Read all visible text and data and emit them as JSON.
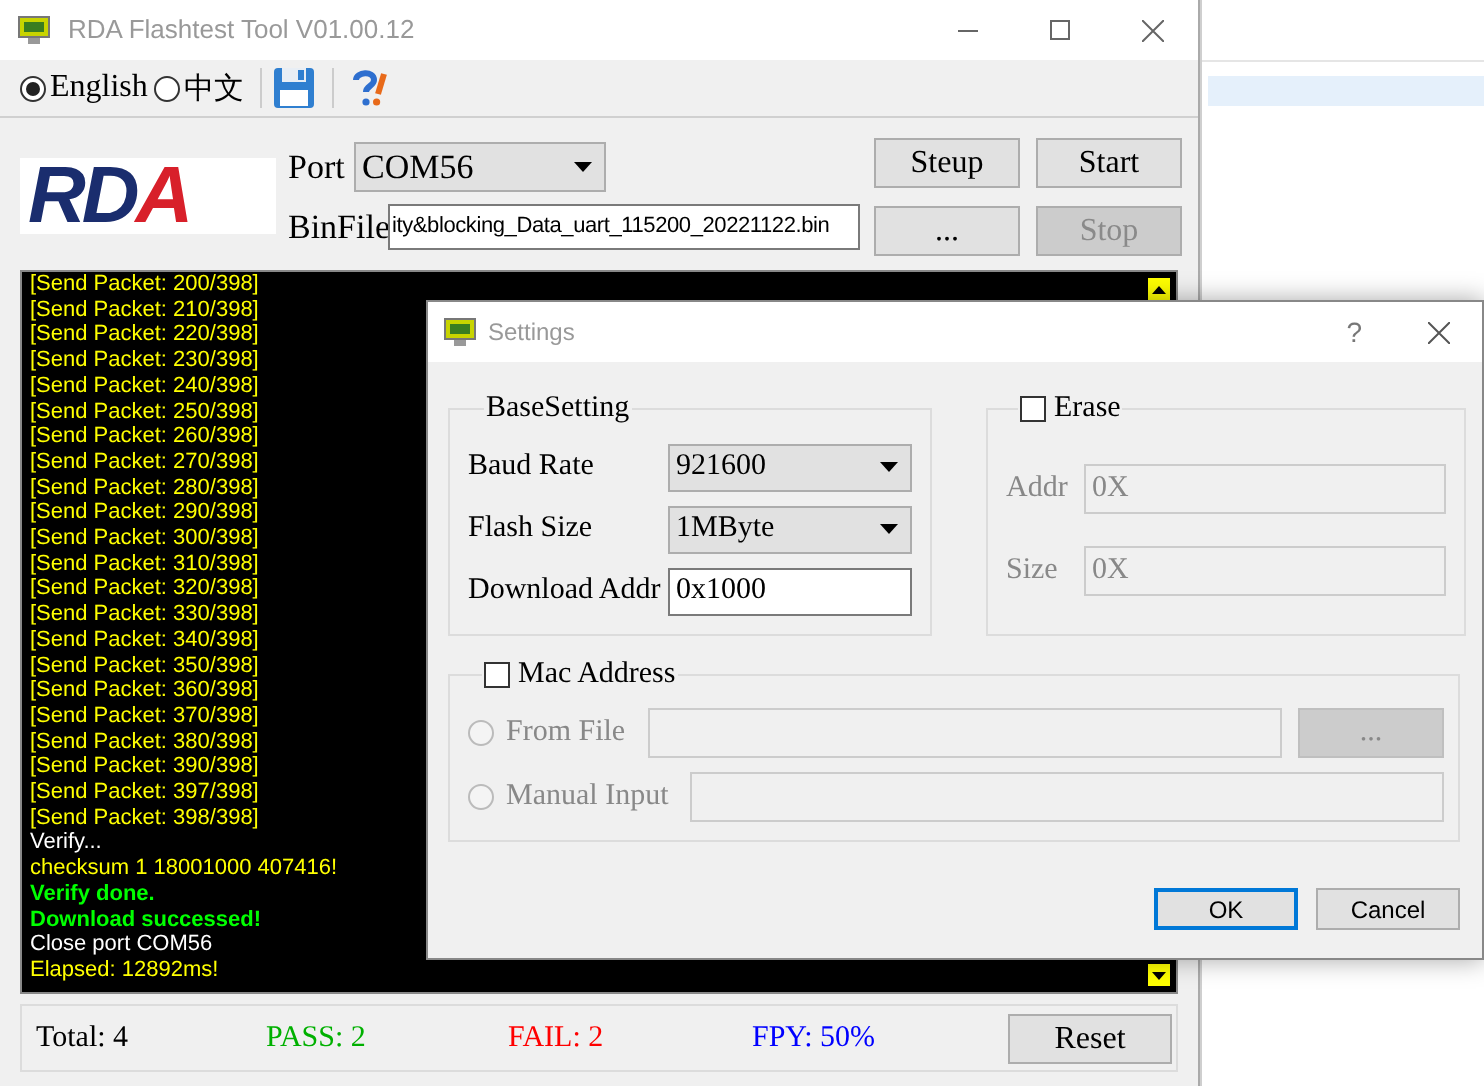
{
  "main_window": {
    "title": "RDA Flashtest Tool V01.00.12",
    "language_options": [
      {
        "label": "English",
        "selected": true
      },
      {
        "label": "中文",
        "selected": false
      }
    ],
    "logo": {
      "text": "RDA"
    },
    "port": {
      "label": "Port",
      "value": "COM56"
    },
    "bin_file": {
      "label": "BinFile",
      "value": "ity&blocking_Data_uart_115200_20221122.bin"
    },
    "buttons": [
      {
        "label": "Steup",
        "disabled": false
      },
      {
        "label": "Start",
        "disabled": false
      },
      {
        "label": "...",
        "disabled": false
      },
      {
        "label": "Stop",
        "disabled": true
      }
    ],
    "log": [
      {
        "text": "[Send Packet: 200/398]",
        "kind": "packet"
      },
      {
        "text": "[Send Packet: 210/398]",
        "kind": "packet"
      },
      {
        "text": "[Send Packet: 220/398]",
        "kind": "packet"
      },
      {
        "text": "[Send Packet: 230/398]",
        "kind": "packet"
      },
      {
        "text": "[Send Packet: 240/398]",
        "kind": "packet"
      },
      {
        "text": "[Send Packet: 250/398]",
        "kind": "packet"
      },
      {
        "text": "[Send Packet: 260/398]",
        "kind": "packet"
      },
      {
        "text": "[Send Packet: 270/398]",
        "kind": "packet"
      },
      {
        "text": "[Send Packet: 280/398]",
        "kind": "packet"
      },
      {
        "text": "[Send Packet: 290/398]",
        "kind": "packet"
      },
      {
        "text": "[Send Packet: 300/398]",
        "kind": "packet"
      },
      {
        "text": "[Send Packet: 310/398]",
        "kind": "packet"
      },
      {
        "text": "[Send Packet: 320/398]",
        "kind": "packet"
      },
      {
        "text": "[Send Packet: 330/398]",
        "kind": "packet"
      },
      {
        "text": "[Send Packet: 340/398]",
        "kind": "packet"
      },
      {
        "text": "[Send Packet: 350/398]",
        "kind": "packet"
      },
      {
        "text": "[Send Packet: 360/398]",
        "kind": "packet"
      },
      {
        "text": "[Send Packet: 370/398]",
        "kind": "packet"
      },
      {
        "text": "[Send Packet: 380/398]",
        "kind": "packet"
      },
      {
        "text": "[Send Packet: 390/398]",
        "kind": "packet"
      },
      {
        "text": "[Send Packet: 397/398]",
        "kind": "packet"
      },
      {
        "text": "[Send Packet: 398/398]",
        "kind": "packet"
      },
      {
        "text": "Verify...",
        "kind": "info"
      },
      {
        "text": "checksum 1 18001000 407416!",
        "kind": "packet"
      },
      {
        "text": "Verify done.",
        "kind": "success"
      },
      {
        "text": "Download successed!",
        "kind": "success"
      },
      {
        "text": "Close port COM56",
        "kind": "info"
      },
      {
        "text": "Elapsed: 12892ms!",
        "kind": "packet"
      }
    ],
    "stats": [
      {
        "text": "Total: 4",
        "color": "#000000"
      },
      {
        "text": "PASS: 2",
        "color": "#00b000"
      },
      {
        "text": "FAIL: 2",
        "color": "#ff0000"
      },
      {
        "text": "FPY: 50%",
        "color": "#0000ff"
      }
    ],
    "reset_button": "Reset"
  },
  "settings_dialog": {
    "title": "Settings",
    "help": "?",
    "base_setting": {
      "title": "BaseSetting",
      "fields": [
        {
          "kind": "dropdown",
          "label": "Baud Rate",
          "value": "921600"
        },
        {
          "kind": "dropdown",
          "label": "Flash Size",
          "value": "1MByte"
        },
        {
          "kind": "text",
          "label": "Download Addr",
          "value": "0x1000"
        }
      ]
    },
    "erase": {
      "label": "Erase",
      "checked": false,
      "fields": [
        {
          "label": "Addr",
          "value": "0X",
          "disabled": true
        },
        {
          "label": "Size",
          "value": "0X",
          "disabled": true
        }
      ]
    },
    "mac_address": {
      "label": "Mac Address",
      "checked": false,
      "options": [
        {
          "label": "From File",
          "selected": false,
          "disabled": true
        },
        {
          "label": "Manual Input",
          "selected": false,
          "disabled": true
        }
      ],
      "browse_button": "..."
    },
    "buttons": [
      {
        "label": "OK",
        "default": true
      },
      {
        "label": "Cancel",
        "default": false
      }
    ]
  }
}
